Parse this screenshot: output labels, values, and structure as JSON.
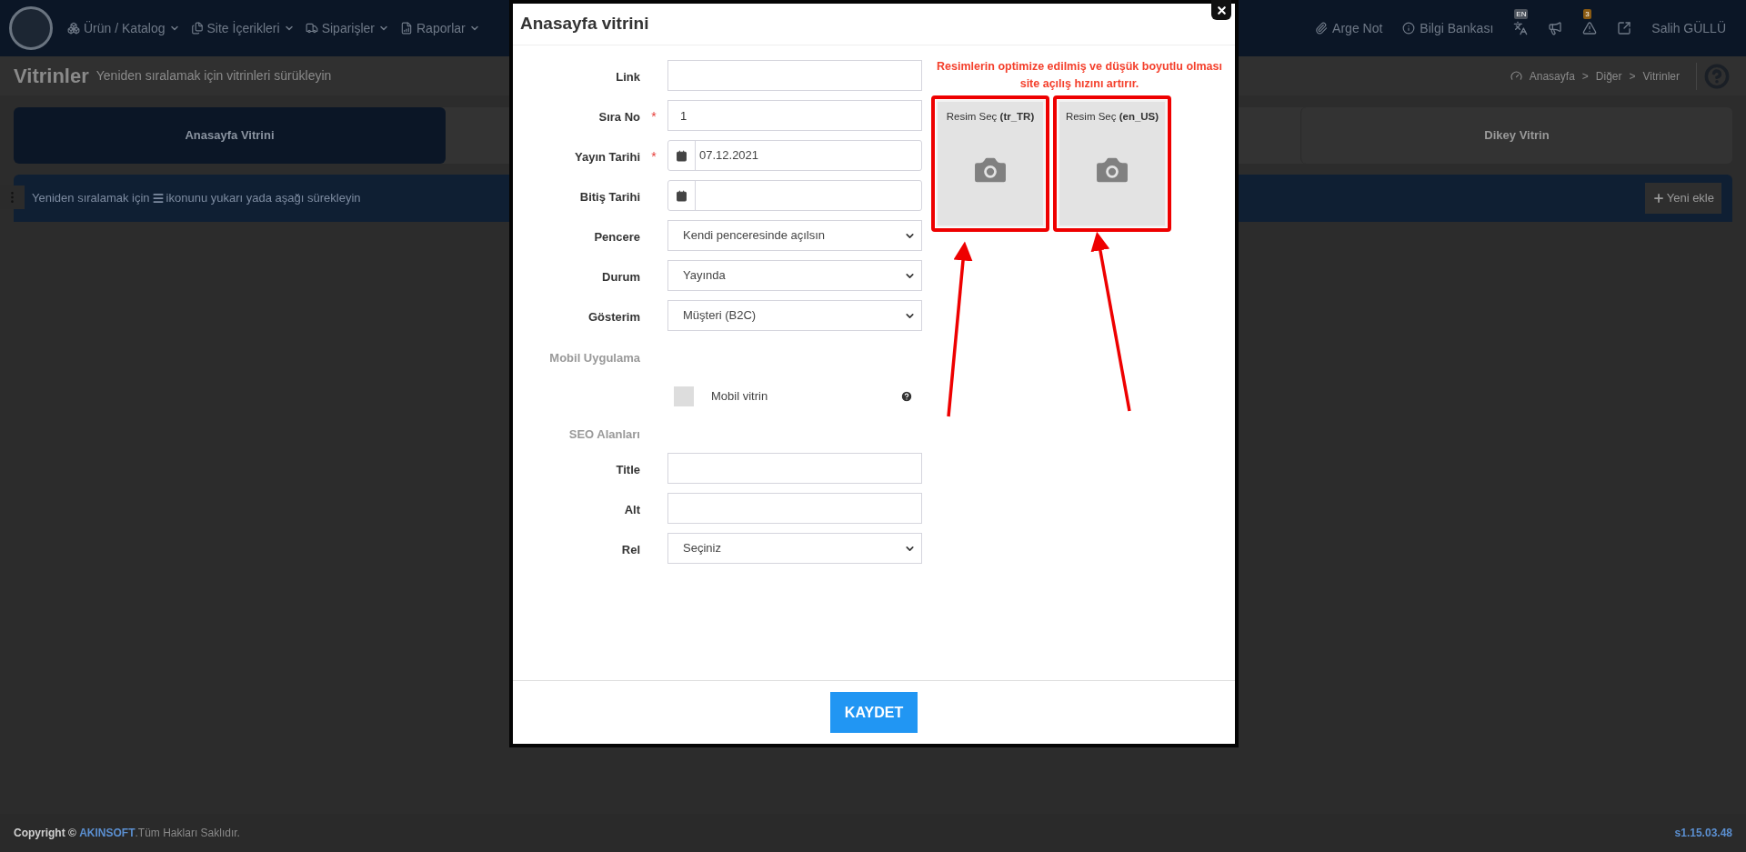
{
  "navbar": {
    "items": [
      {
        "label": "Ürün / Katalog",
        "kind": "boxes"
      },
      {
        "label": "Site İçerikleri",
        "kind": "files"
      },
      {
        "label": "Siparişler",
        "kind": "truck"
      },
      {
        "label": "Raporlar",
        "kind": "report"
      }
    ],
    "links": [
      {
        "label": "Arge Not",
        "kind": "paperclip"
      },
      {
        "label": "Bilgi Bankası",
        "kind": "info"
      }
    ],
    "icons": [
      {
        "kind": "translate",
        "badge": "EN"
      },
      {
        "kind": "megaphone"
      },
      {
        "kind": "warning",
        "badge": "3"
      },
      {
        "kind": "external"
      }
    ],
    "user": "Salih GÜLLÜ"
  },
  "page_header": {
    "title": "Vitrinler",
    "subtitle": "Yeniden sıralamak için vitrinleri sürükleyin",
    "breadcrumb": [
      "Anasayfa",
      "Diğer",
      "Vitrinler"
    ],
    "separator": ">"
  },
  "tabs": [
    {
      "label": "Anasayfa Vitrini",
      "selected": true
    },
    {
      "label": "Dikey Vitrin",
      "selected": false
    }
  ],
  "info_bar": {
    "text_before": "Yeniden sıralamak için",
    "text_after": "ikonunu yukarı yada aşağı sürekleyin",
    "button": "Yeni ekle"
  },
  "modal": {
    "title": "Anasayfa vitrini",
    "required_mark": "*",
    "fields": [
      {
        "label": "Link",
        "kind": "text",
        "required": false
      },
      {
        "label": "Sıra No",
        "kind": "text",
        "required": true,
        "value": "1"
      },
      {
        "label": "Yayın Tarihi",
        "kind": "date",
        "required": true,
        "value": "07.12.2021"
      },
      {
        "label": "Bitiş Tarihi",
        "kind": "date",
        "required": false
      },
      {
        "label": "Pencere",
        "kind": "select",
        "required": false,
        "value": "Kendi penceresinde açılsın"
      },
      {
        "label": "Durum",
        "kind": "select",
        "required": false,
        "value": "Yayında"
      },
      {
        "label": "Gösterim",
        "kind": "select",
        "required": false,
        "value": "Müşteri (B2C)"
      },
      {
        "label": "Mobil Uygulama",
        "kind": "section"
      },
      {
        "label": "Mobil vitrin",
        "kind": "checkbox",
        "checked": false
      },
      {
        "label": "SEO Alanları",
        "kind": "section"
      },
      {
        "label": "Title",
        "kind": "text",
        "required": false
      },
      {
        "label": "Alt",
        "kind": "text",
        "required": false
      },
      {
        "label": "Rel",
        "kind": "select",
        "required": false,
        "value": "Seçiniz"
      }
    ],
    "image_notice": "Resimlerin optimize edilmiş ve düşük boyutlu olması site açılış hızını artırır.",
    "image_pickers": [
      {
        "label": "Resim Seç **(tr_TR)**"
      },
      {
        "label": "Resim Seç **(en_US)**"
      }
    ],
    "save_button": "KAYDET"
  },
  "footer": {
    "prefix": "Copyright ©",
    "brand": "AKINSOFT",
    "suffix": ".Tüm Hakları Saklıdır.",
    "version": "s1.15.03.48"
  }
}
